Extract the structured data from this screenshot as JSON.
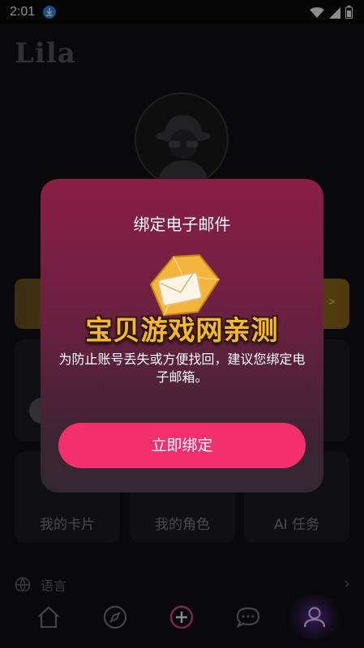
{
  "status_bar": {
    "time": "2:01",
    "icons": [
      "download-icon",
      "wifi-icon",
      "signal-icon",
      "battery-icon"
    ]
  },
  "app": {
    "logo": "Lila"
  },
  "cards": [
    {
      "label": "我的卡片",
      "icon": "card-icon"
    },
    {
      "label": "我的角色",
      "icon": "character-icon"
    },
    {
      "label": "AI 任务",
      "icon": "task-icon"
    }
  ],
  "settings": {
    "language_label": "语言"
  },
  "tab_bar": {
    "tabs": [
      "home-icon",
      "discover-icon",
      "create-icon",
      "messages-icon",
      "profile-icon"
    ],
    "active": "profile"
  },
  "dialog": {
    "title": "绑定电子邮件",
    "watermark": "宝贝游戏网亲测",
    "message": "为防止账号丢失或方便找回，建议您绑定电子邮箱。",
    "button_label": "立即绑定"
  },
  "colors": {
    "accent": "#f2306e",
    "dialog_top": "#8a1f44",
    "active_tab": "#6b2cb3"
  }
}
